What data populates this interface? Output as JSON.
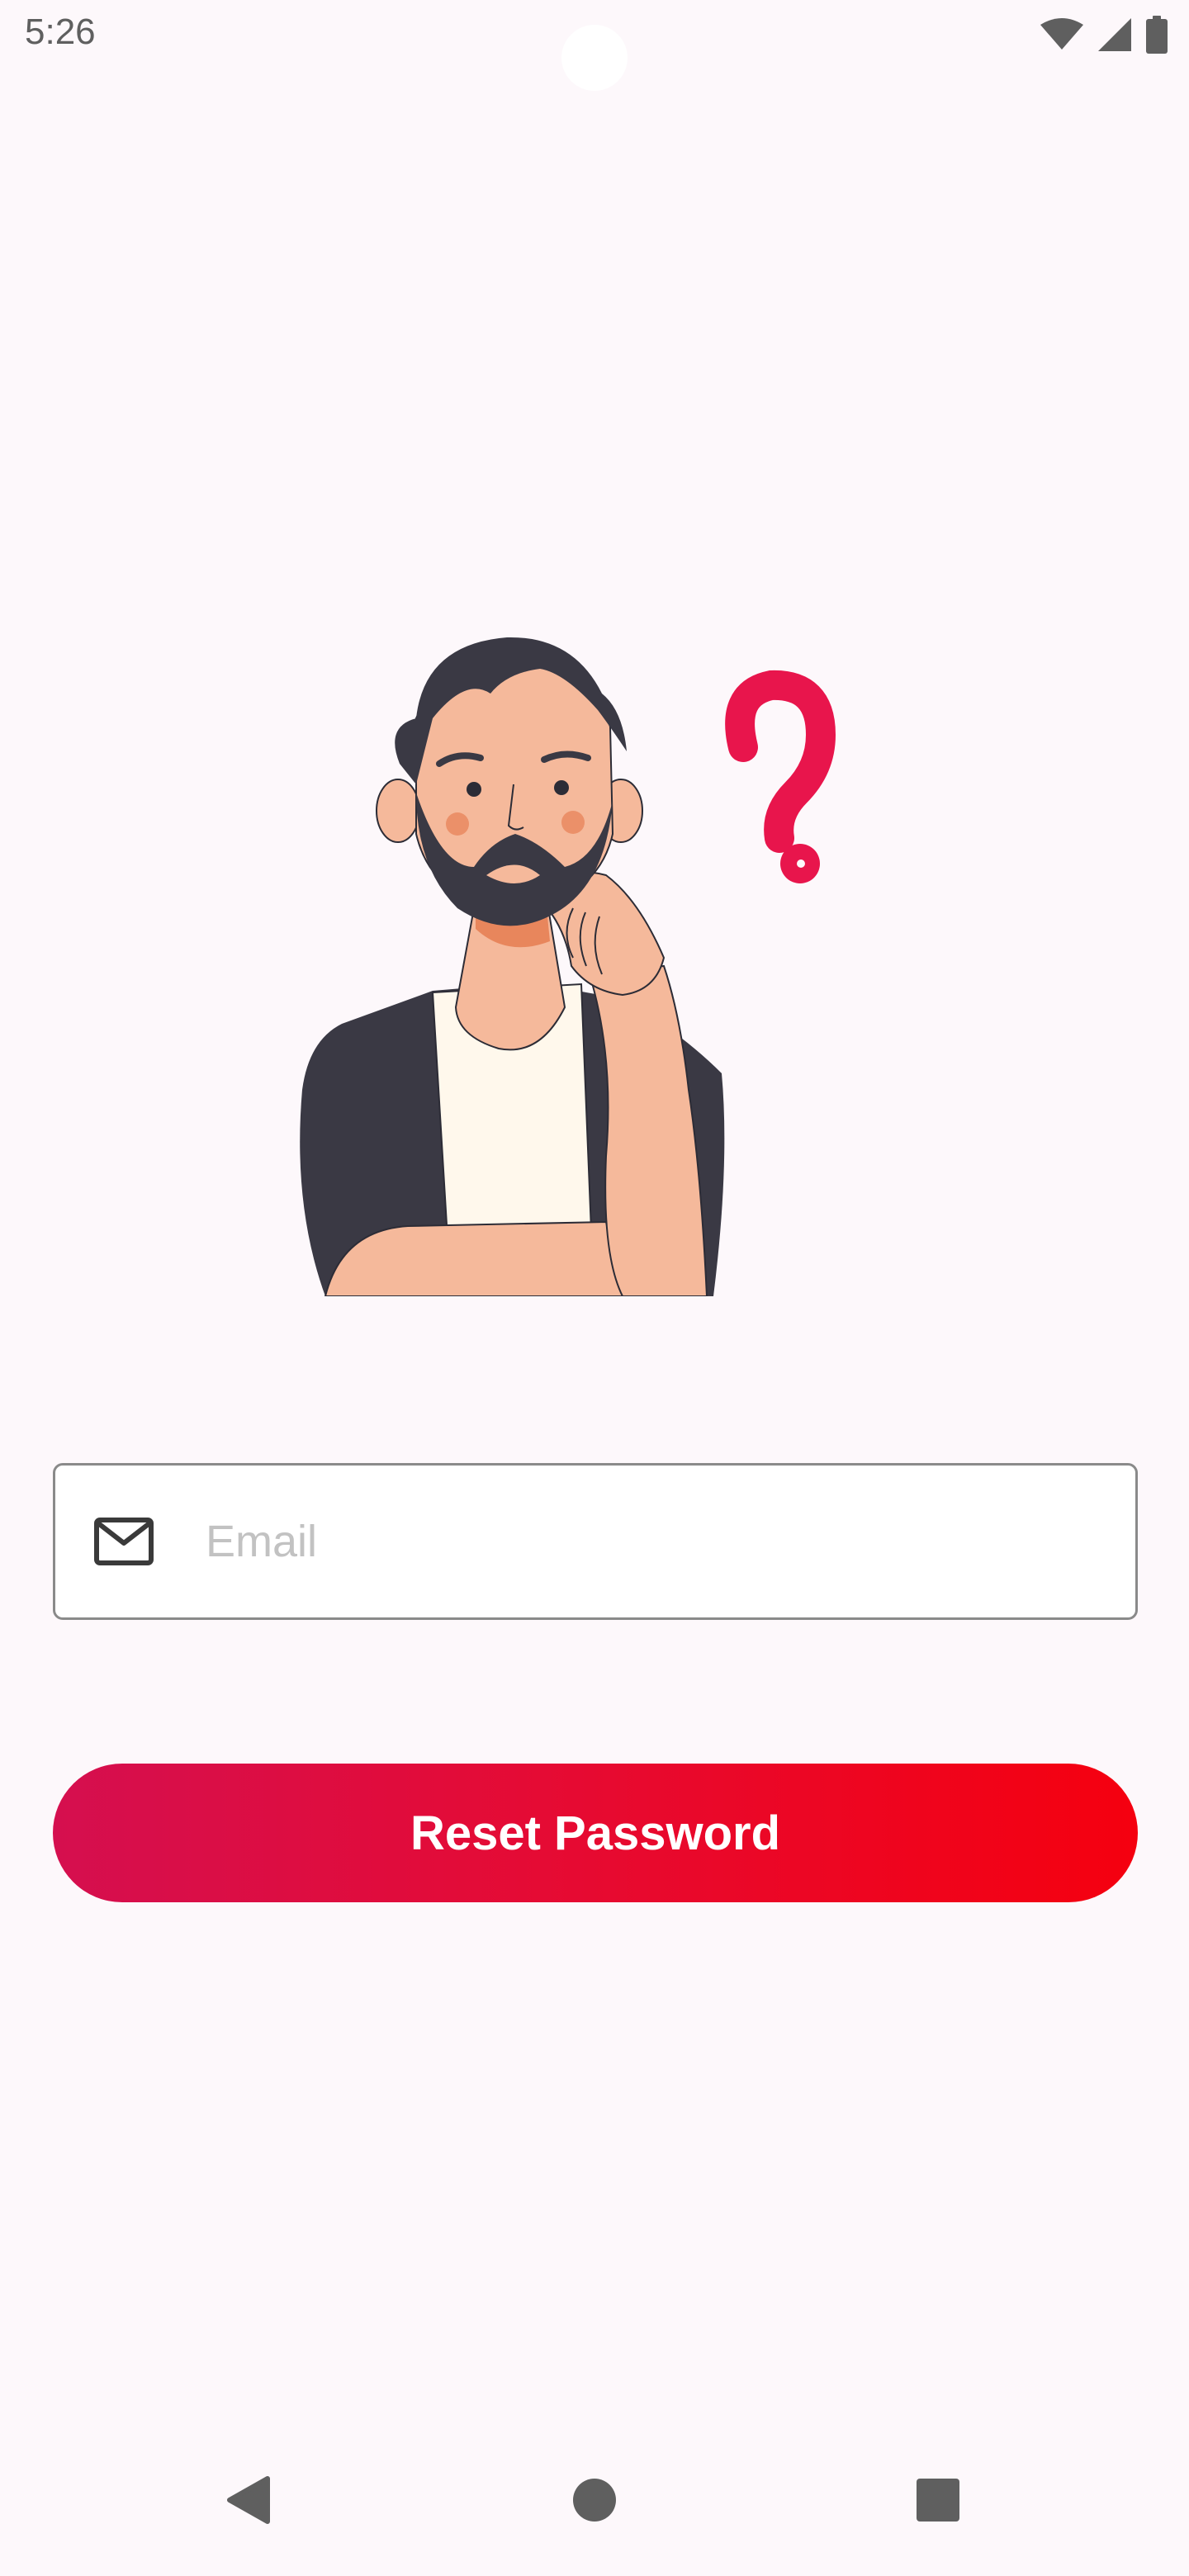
{
  "status_bar": {
    "time": "5:26",
    "icons": [
      "wifi-icon",
      "cellular-signal-icon",
      "battery-icon"
    ]
  },
  "illustration": {
    "name": "thinking-man-with-question-mark",
    "accent_color": "#e8154c"
  },
  "form": {
    "email": {
      "icon": "mail-icon",
      "placeholder": "Email",
      "value": ""
    },
    "reset_button": {
      "label": "Reset Password",
      "gradient_start": "#d50f4f",
      "gradient_end": "#f5000f"
    }
  },
  "nav_bar": {
    "buttons": [
      "back-icon",
      "home-icon",
      "recents-icon"
    ]
  }
}
